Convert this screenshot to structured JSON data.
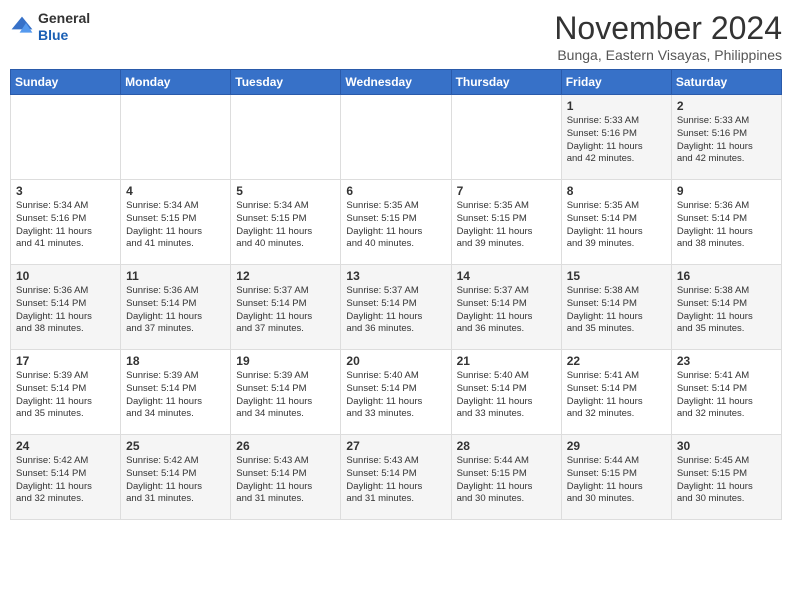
{
  "header": {
    "logo_line1": "General",
    "logo_line2": "Blue",
    "month_year": "November 2024",
    "location": "Bunga, Eastern Visayas, Philippines"
  },
  "weekdays": [
    "Sunday",
    "Monday",
    "Tuesday",
    "Wednesday",
    "Thursday",
    "Friday",
    "Saturday"
  ],
  "weeks": [
    [
      {
        "day": "",
        "info": ""
      },
      {
        "day": "",
        "info": ""
      },
      {
        "day": "",
        "info": ""
      },
      {
        "day": "",
        "info": ""
      },
      {
        "day": "",
        "info": ""
      },
      {
        "day": "1",
        "info": "Sunrise: 5:33 AM\nSunset: 5:16 PM\nDaylight: 11 hours\nand 42 minutes."
      },
      {
        "day": "2",
        "info": "Sunrise: 5:33 AM\nSunset: 5:16 PM\nDaylight: 11 hours\nand 42 minutes."
      }
    ],
    [
      {
        "day": "3",
        "info": "Sunrise: 5:34 AM\nSunset: 5:16 PM\nDaylight: 11 hours\nand 41 minutes."
      },
      {
        "day": "4",
        "info": "Sunrise: 5:34 AM\nSunset: 5:15 PM\nDaylight: 11 hours\nand 41 minutes."
      },
      {
        "day": "5",
        "info": "Sunrise: 5:34 AM\nSunset: 5:15 PM\nDaylight: 11 hours\nand 40 minutes."
      },
      {
        "day": "6",
        "info": "Sunrise: 5:35 AM\nSunset: 5:15 PM\nDaylight: 11 hours\nand 40 minutes."
      },
      {
        "day": "7",
        "info": "Sunrise: 5:35 AM\nSunset: 5:15 PM\nDaylight: 11 hours\nand 39 minutes."
      },
      {
        "day": "8",
        "info": "Sunrise: 5:35 AM\nSunset: 5:14 PM\nDaylight: 11 hours\nand 39 minutes."
      },
      {
        "day": "9",
        "info": "Sunrise: 5:36 AM\nSunset: 5:14 PM\nDaylight: 11 hours\nand 38 minutes."
      }
    ],
    [
      {
        "day": "10",
        "info": "Sunrise: 5:36 AM\nSunset: 5:14 PM\nDaylight: 11 hours\nand 38 minutes."
      },
      {
        "day": "11",
        "info": "Sunrise: 5:36 AM\nSunset: 5:14 PM\nDaylight: 11 hours\nand 37 minutes."
      },
      {
        "day": "12",
        "info": "Sunrise: 5:37 AM\nSunset: 5:14 PM\nDaylight: 11 hours\nand 37 minutes."
      },
      {
        "day": "13",
        "info": "Sunrise: 5:37 AM\nSunset: 5:14 PM\nDaylight: 11 hours\nand 36 minutes."
      },
      {
        "day": "14",
        "info": "Sunrise: 5:37 AM\nSunset: 5:14 PM\nDaylight: 11 hours\nand 36 minutes."
      },
      {
        "day": "15",
        "info": "Sunrise: 5:38 AM\nSunset: 5:14 PM\nDaylight: 11 hours\nand 35 minutes."
      },
      {
        "day": "16",
        "info": "Sunrise: 5:38 AM\nSunset: 5:14 PM\nDaylight: 11 hours\nand 35 minutes."
      }
    ],
    [
      {
        "day": "17",
        "info": "Sunrise: 5:39 AM\nSunset: 5:14 PM\nDaylight: 11 hours\nand 35 minutes."
      },
      {
        "day": "18",
        "info": "Sunrise: 5:39 AM\nSunset: 5:14 PM\nDaylight: 11 hours\nand 34 minutes."
      },
      {
        "day": "19",
        "info": "Sunrise: 5:39 AM\nSunset: 5:14 PM\nDaylight: 11 hours\nand 34 minutes."
      },
      {
        "day": "20",
        "info": "Sunrise: 5:40 AM\nSunset: 5:14 PM\nDaylight: 11 hours\nand 33 minutes."
      },
      {
        "day": "21",
        "info": "Sunrise: 5:40 AM\nSunset: 5:14 PM\nDaylight: 11 hours\nand 33 minutes."
      },
      {
        "day": "22",
        "info": "Sunrise: 5:41 AM\nSunset: 5:14 PM\nDaylight: 11 hours\nand 32 minutes."
      },
      {
        "day": "23",
        "info": "Sunrise: 5:41 AM\nSunset: 5:14 PM\nDaylight: 11 hours\nand 32 minutes."
      }
    ],
    [
      {
        "day": "24",
        "info": "Sunrise: 5:42 AM\nSunset: 5:14 PM\nDaylight: 11 hours\nand 32 minutes."
      },
      {
        "day": "25",
        "info": "Sunrise: 5:42 AM\nSunset: 5:14 PM\nDaylight: 11 hours\nand 31 minutes."
      },
      {
        "day": "26",
        "info": "Sunrise: 5:43 AM\nSunset: 5:14 PM\nDaylight: 11 hours\nand 31 minutes."
      },
      {
        "day": "27",
        "info": "Sunrise: 5:43 AM\nSunset: 5:14 PM\nDaylight: 11 hours\nand 31 minutes."
      },
      {
        "day": "28",
        "info": "Sunrise: 5:44 AM\nSunset: 5:15 PM\nDaylight: 11 hours\nand 30 minutes."
      },
      {
        "day": "29",
        "info": "Sunrise: 5:44 AM\nSunset: 5:15 PM\nDaylight: 11 hours\nand 30 minutes."
      },
      {
        "day": "30",
        "info": "Sunrise: 5:45 AM\nSunset: 5:15 PM\nDaylight: 11 hours\nand 30 minutes."
      }
    ]
  ]
}
